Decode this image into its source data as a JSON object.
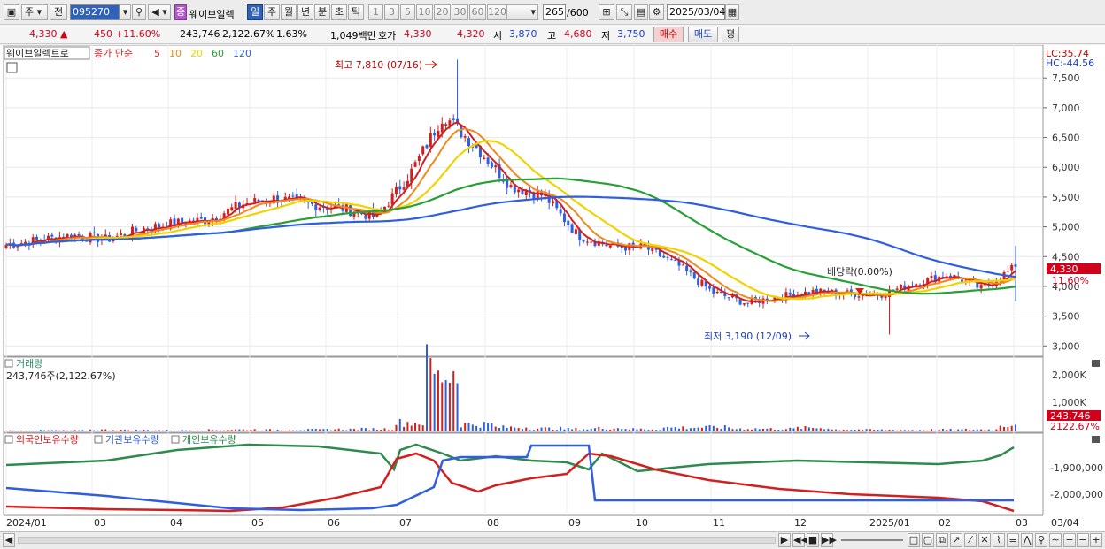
{
  "toolbar": {
    "market": "주",
    "prev": "전",
    "code": "095270",
    "stock_name": "웨이브일렉",
    "stock_badge": "종",
    "periods": [
      {
        "label": "일",
        "selected": true
      },
      {
        "label": "주",
        "selected": false
      },
      {
        "label": "월",
        "selected": false
      },
      {
        "label": "년",
        "selected": false
      },
      {
        "label": "분",
        "selected": false
      },
      {
        "label": "초",
        "selected": false
      },
      {
        "label": "틱",
        "selected": false
      }
    ],
    "minutes": [
      "1",
      "3",
      "5",
      "10",
      "20",
      "30",
      "60",
      "120"
    ],
    "count": "265",
    "total": "/600",
    "date": "2025/03/04"
  },
  "quote": {
    "price": "4,330",
    "up_mark": "▲",
    "change": "450",
    "change_pct": "+11.60%",
    "volume": "243,746",
    "volume_pct": "2,122.67%",
    "turnover": "1.63%",
    "amount": "1,049백만",
    "bid_label": "호가",
    "bid1": "4,330",
    "bid2": "4,320",
    "open_label": "시",
    "open": "3,870",
    "high_label": "고",
    "high": "4,680",
    "low_label": "저",
    "low": "3,750",
    "buy": "매수",
    "sell": "매도",
    "avg": "평"
  },
  "price_panel": {
    "name": "웨이브일렉트로",
    "legend_prefix": "종가 단순",
    "ma": [
      {
        "label": "5",
        "color": "#d21f1f"
      },
      {
        "label": "10",
        "color": "#f08a1c"
      },
      {
        "label": "20",
        "color": "#f0d400"
      },
      {
        "label": "60",
        "color": "#27a036"
      },
      {
        "label": "120",
        "color": "#2f5fe0"
      }
    ],
    "high_note": "최고 7,810 (07/16)",
    "low_note": "최저 3,190 (12/09)",
    "div_note": "배당락(0.00%)",
    "lc": "LC:35.74",
    "hc": "HC:-44.56",
    "price_badge": "4,330",
    "pct_badge": "11.60%",
    "yticks": [
      "7,500",
      "7,000",
      "6,500",
      "6,000",
      "5,500",
      "5,000",
      "4,500",
      "4,000",
      "3,500",
      "3,000"
    ]
  },
  "volume_panel": {
    "title": "거래량",
    "info": "243,746주(2,122.67%)",
    "yticks": [
      "2,000K",
      "1,000K"
    ],
    "badge1": "243,746",
    "badge2": "2122.67%"
  },
  "holdings_panel": {
    "s1": "외국인보유수량",
    "s2": "기관보유수량",
    "s3": "개인보유수량",
    "yticks": [
      "-1,900,000",
      "-2,000,000"
    ]
  },
  "xaxis": [
    "2024/01",
    "03",
    "04",
    "05",
    "06",
    "07",
    "08",
    "09",
    "10",
    "11",
    "12",
    "2025/01",
    "02",
    "03",
    "03/04"
  ],
  "chart_data": {
    "type": "line",
    "title": "",
    "series": [
      {
        "name": "종가",
        "values": [
          4700,
          4780,
          4860,
          4790,
          4960,
          5060,
          5120,
          5380,
          5480,
          5380,
          5310,
          5160,
          5890,
          6880,
          6320,
          5680,
          5520,
          4850,
          4670,
          4650,
          4340,
          3900,
          3720,
          3830,
          3910,
          3880,
          3870,
          4050,
          4200,
          3960,
          4330
        ]
      },
      {
        "name": "거래량",
        "values": [
          30,
          40,
          35,
          60,
          50,
          45,
          55,
          70,
          60,
          65,
          80,
          90,
          320,
          2200,
          260,
          150,
          110,
          90,
          120,
          85,
          140,
          150,
          100,
          95,
          130,
          70,
          60,
          55,
          65,
          70,
          244
        ]
      }
    ],
    "ylim": [
      3000,
      7810
    ],
    "high": 7810,
    "low": 3190
  }
}
